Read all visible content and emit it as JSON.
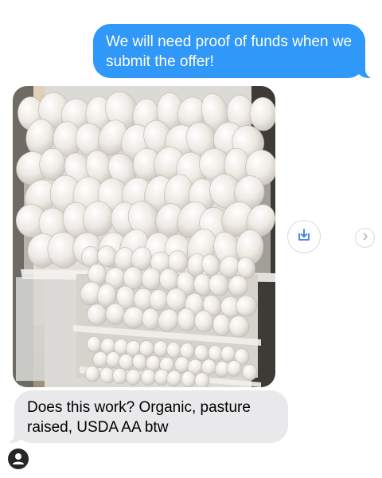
{
  "messages": {
    "outgoing": {
      "text": "We will need proof of funds when we submit the offer!",
      "color": "#2f98f8"
    },
    "attachment": {
      "subject": "open refrigerator packed with eggs"
    },
    "incoming": {
      "text": "Does this work? Organic, pasture raised, USDA AA btw",
      "color": "#e9e9eb"
    }
  },
  "actions": {
    "save_icon": "download-to-tray-icon",
    "next_icon": "chevron-right-icon"
  },
  "sender": {
    "avatar_icon": "person-silhouette-icon"
  }
}
